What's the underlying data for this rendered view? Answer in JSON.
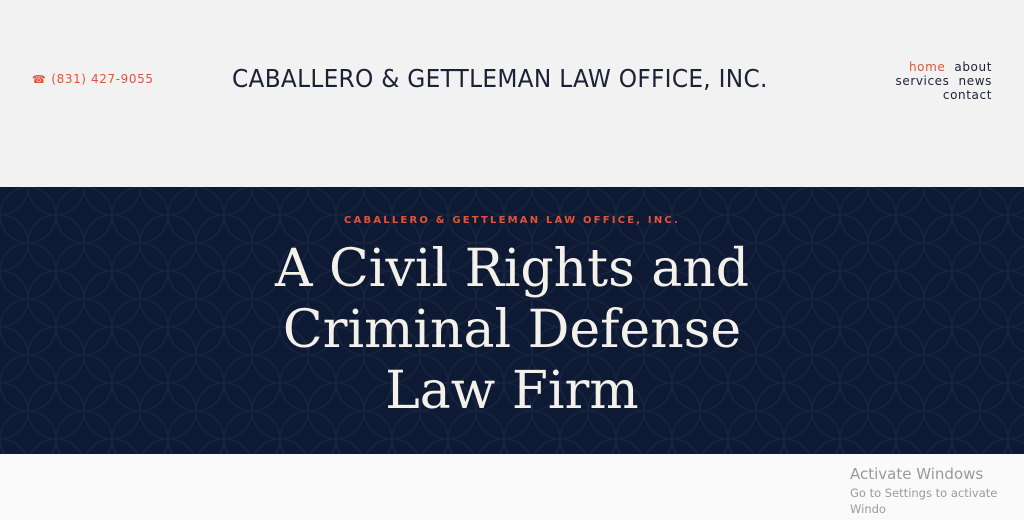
{
  "header": {
    "phone": "(831) 427-9055",
    "phone_icon": "telephone-icon",
    "site_title": "CABALLERO & GETTLEMAN LAW OFFICE, INC.",
    "nav": {
      "home": "home",
      "about": "about",
      "services": "services",
      "news": "news",
      "contact": "contact"
    }
  },
  "hero": {
    "eyebrow": "CABALLERO & GETTLEMAN LAW OFFICE, INC.",
    "headline_lines": [
      "A Civil Rights and",
      "Criminal Defense",
      "Law Firm"
    ]
  },
  "watermark": {
    "title": "Activate Windows",
    "subtitle": "Go to Settings to activate Windo"
  },
  "colors": {
    "accent": "#e2533a",
    "navy": "#0e1a34",
    "text_dark": "#1c2236",
    "background": "#f2f2f2"
  }
}
